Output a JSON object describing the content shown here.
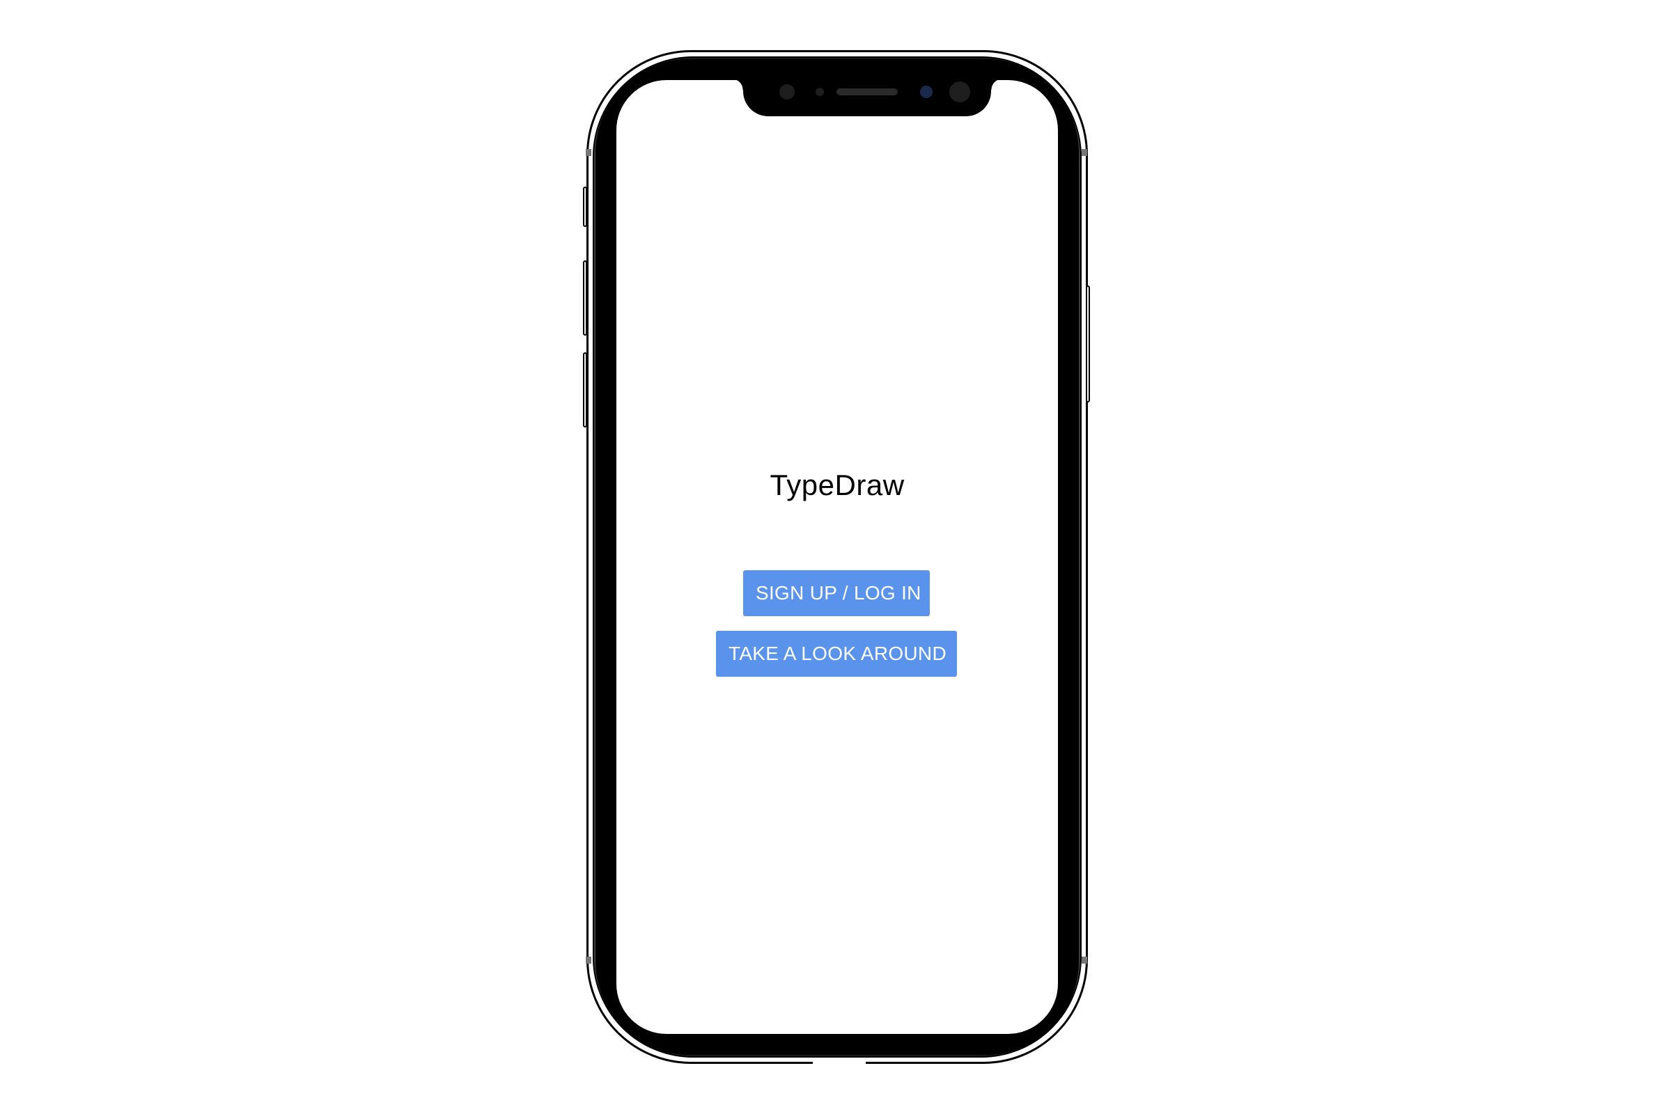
{
  "device": {
    "type": "phone-mockup"
  },
  "app": {
    "title": "TypeDraw"
  },
  "actions": {
    "signup_label": "SIGN UP / LOG IN",
    "look_label": "TAKE A LOOK AROUND"
  },
  "colors": {
    "button_bg": "#5a93ec",
    "button_text": "#ffffff",
    "screen_bg": "#ffffff",
    "title_text": "#000000"
  }
}
